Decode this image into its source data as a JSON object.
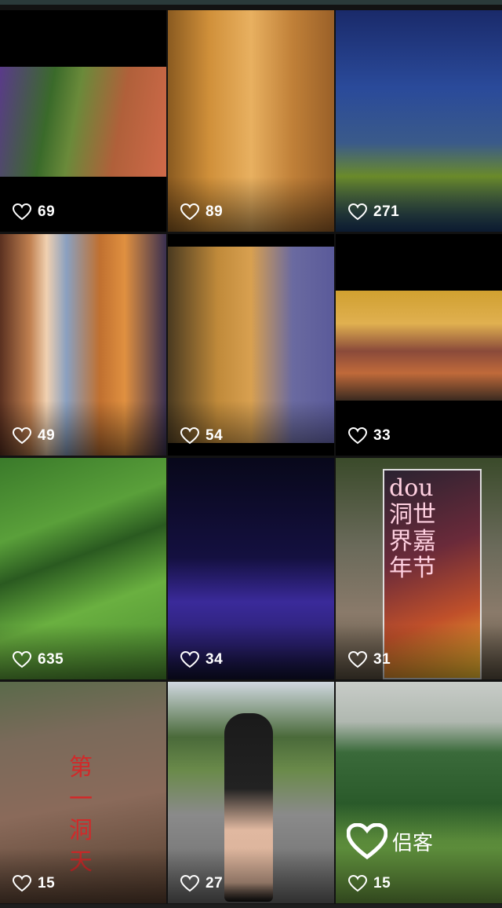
{
  "grid": {
    "tiles": [
      {
        "likes": "69"
      },
      {
        "likes": "89"
      },
      {
        "likes": "271"
      },
      {
        "likes": "49"
      },
      {
        "likes": "54"
      },
      {
        "likes": "33"
      },
      {
        "likes": "635"
      },
      {
        "likes": "34"
      },
      {
        "likes": "31"
      },
      {
        "likes": "15"
      },
      {
        "likes": "27"
      },
      {
        "likes": "15"
      }
    ]
  },
  "sign": {
    "text": "dou洞世界嘉年节"
  },
  "rock_text": {
    "text": "第一洞天"
  },
  "watermark": {
    "text": "侣客"
  }
}
